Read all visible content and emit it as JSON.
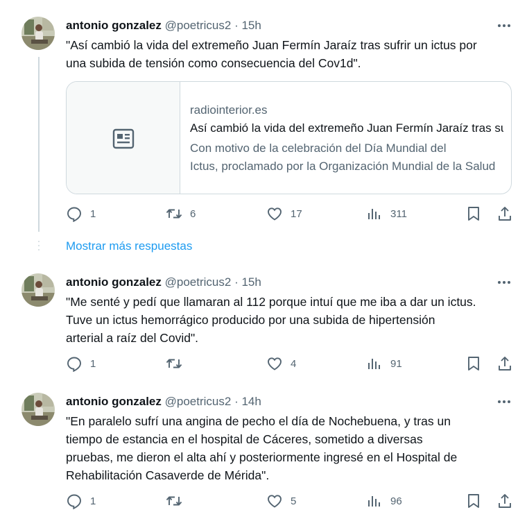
{
  "tweets": [
    {
      "author": "antonio gonzalez",
      "handle": "@poetricus2",
      "separator": "·",
      "time": "15h",
      "text_lines": [
        "\"Así cambió la vida del extremeño Juan Fermín Jaraíz tras sufrir un ictus por",
        "una subida de tensión como consecuencia del Cov1d\"."
      ],
      "card": {
        "domain": "radiointerior.es",
        "title": "Así cambió la vida del extremeño Juan Fermín Jaraíz tras sufrir un ictus",
        "desc_lines": [
          "Con motivo de la celebración del Día Mundial del",
          "Ictus, proclamado por la Organización Mundial de la Salud"
        ]
      },
      "replies": "1",
      "retweets": "6",
      "likes": "17",
      "views": "311"
    },
    {
      "author": "antonio gonzalez",
      "handle": "@poetricus2",
      "separator": "·",
      "time": "15h",
      "text_lines": [
        "\"Me senté y pedí que llamaran al 112 porque intuí que me iba a dar un ictus.",
        "Tuve un ictus hemorrágico producido por una subida de hipertensión",
        "arterial a raíz del Covid\"."
      ],
      "replies": "1",
      "retweets": "",
      "likes": "4",
      "views": "91"
    },
    {
      "author": "antonio gonzalez",
      "handle": "@poetricus2",
      "separator": "·",
      "time": "14h",
      "text_lines": [
        "\"En paralelo sufrí una angina de pecho el día de Nochebuena, y tras un",
        "tiempo de estancia en el hospital de Cáceres, sometido a diversas",
        "pruebas, me dieron el alta ahí y posteriormente ingresé en el Hospital de",
        "Rehabilitación Casaverde de Mérida\"."
      ],
      "replies": "1",
      "retweets": "",
      "likes": "5",
      "views": "96"
    }
  ],
  "show_more_replies": "Mostrar más respuestas",
  "icons": {
    "more": "more-horizontal-icon",
    "reply": "reply-icon",
    "retweet": "retweet-icon",
    "like": "heart-icon",
    "views": "views-icon",
    "bookmark": "bookmark-icon",
    "share": "share-icon",
    "card_placeholder": "article-icon"
  },
  "colors": {
    "text": "#0f1419",
    "secondary": "#536471",
    "link": "#1d9bf0",
    "border": "#cfd9de"
  }
}
